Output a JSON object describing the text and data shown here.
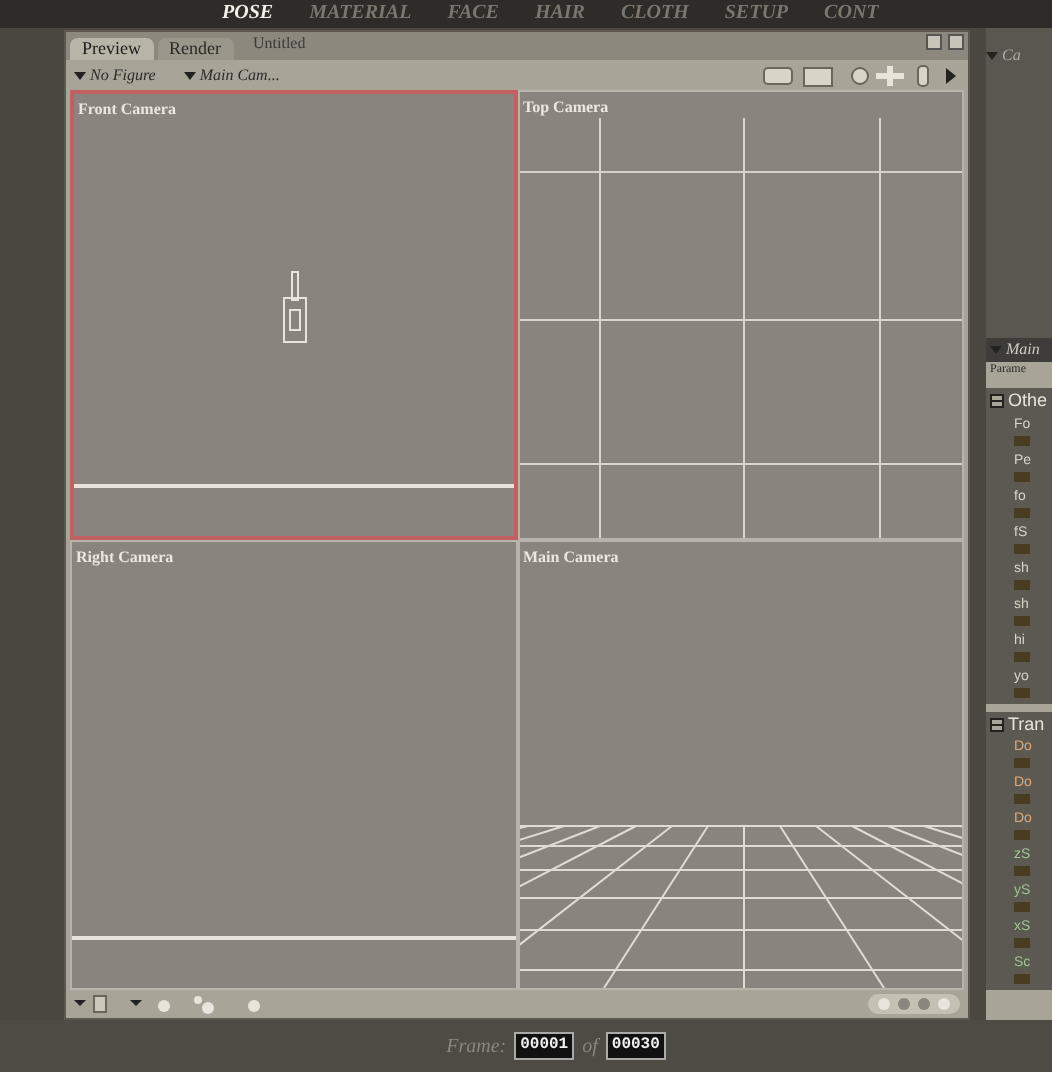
{
  "room_tabs": [
    {
      "label": "POSE",
      "selected": true
    },
    {
      "label": "MATERIAL",
      "selected": false
    },
    {
      "label": "FACE",
      "selected": false
    },
    {
      "label": "HAIR",
      "selected": false
    },
    {
      "label": "CLOTH",
      "selected": false
    },
    {
      "label": "SETUP",
      "selected": false
    },
    {
      "label": "CONT",
      "selected": false
    }
  ],
  "document": {
    "tabs": [
      {
        "label": "Preview",
        "selected": true
      },
      {
        "label": "Render",
        "selected": false
      }
    ],
    "title": "Untitled",
    "figure_menu": "No Figure",
    "camera_menu": "Main Cam...",
    "viewports": [
      {
        "label": "Front Camera",
        "kind": "front",
        "selected": true
      },
      {
        "label": "Top Camera",
        "kind": "top",
        "selected": false
      },
      {
        "label": "Right Camera",
        "kind": "side",
        "selected": false
      },
      {
        "label": "Main Camera",
        "kind": "perspective",
        "selected": false
      }
    ]
  },
  "side_panel": {
    "top_menu": "Ca",
    "header": "Main",
    "subheader": "Parame",
    "groups": [
      {
        "label": "Othe",
        "expanded": true,
        "params": [
          {
            "label": "Fo",
            "color": "#d8d4c8"
          },
          {
            "label": "Pe",
            "color": "#d8d4c8"
          },
          {
            "label": "fo",
            "color": "#d8d4c8"
          },
          {
            "label": "fS",
            "color": "#d8d4c8"
          },
          {
            "label": "sh",
            "color": "#d8d4c8"
          },
          {
            "label": "sh",
            "color": "#d8d4c8"
          },
          {
            "label": "hi",
            "color": "#d8d4c8"
          },
          {
            "label": "yo",
            "color": "#d8d4c8"
          }
        ]
      },
      {
        "label": "Tran",
        "expanded": true,
        "params": [
          {
            "label": "Do",
            "color": "#e0a878"
          },
          {
            "label": "Do",
            "color": "#e0a878"
          },
          {
            "label": "Do",
            "color": "#e0a878"
          },
          {
            "label": "zS",
            "color": "#9cc88c"
          },
          {
            "label": "yS",
            "color": "#9cc88c"
          },
          {
            "label": "xS",
            "color": "#9cc88c"
          },
          {
            "label": "Sc",
            "color": "#9cc88c"
          }
        ]
      }
    ]
  },
  "timeline": {
    "frame_label": "Frame:",
    "frame": "00001",
    "of_label": "of",
    "total": "00030"
  }
}
